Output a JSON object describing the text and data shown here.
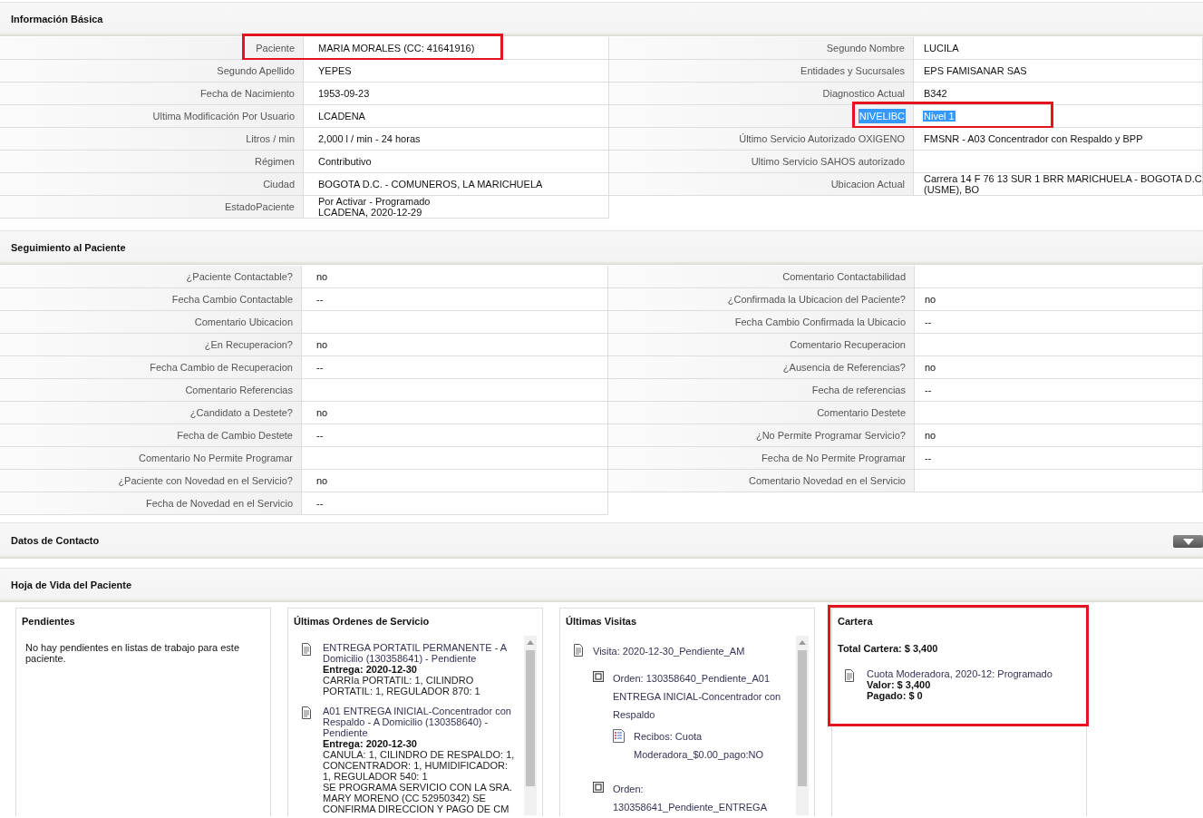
{
  "info_basica": {
    "title": "Información Básica",
    "left_rows": [
      {
        "label": "Paciente",
        "value": "MARIA MORALES (CC: 41641916)",
        "marked": true,
        "selected": false
      },
      {
        "label": "Segundo Apellido",
        "value": "YEPES",
        "marked": false,
        "selected": false
      },
      {
        "label": "Fecha de Nacimiento",
        "value": "1953-09-23",
        "marked": false,
        "selected": false
      },
      {
        "label": "Ultima Modificación Por Usuario",
        "value": "LCADENA",
        "marked": false,
        "selected": false
      },
      {
        "label": "Litros / min",
        "value": "2,000 l / min - 24 horas",
        "marked": false,
        "selected": false
      },
      {
        "label": "Régimen",
        "value": "Contributivo",
        "marked": false,
        "selected": false
      },
      {
        "label": "Ciudad",
        "value": "BOGOTA D.C. - COMUNEROS, LA MARICHUELA",
        "marked": false,
        "selected": false
      },
      {
        "label": "EstadoPaciente",
        "value": "Por Activar - Programado\nLCADENA, 2020-12-29",
        "marked": false,
        "selected": false
      }
    ],
    "right_rows": [
      {
        "label": "Segundo Nombre",
        "value": "LUCILA",
        "marked": false,
        "selected": false
      },
      {
        "label": "Entidades y Sucursales",
        "value": "EPS FAMISANAR SAS",
        "marked": false,
        "selected": false
      },
      {
        "label": "Diagnostico Actual",
        "value": "B342",
        "marked": false,
        "selected": false
      },
      {
        "label": "NIVELIBC",
        "value": "Nivel 1",
        "marked": true,
        "selected": true
      },
      {
        "label": "Último Servicio Autorizado OXIGENO",
        "value": "FMSNR - A03 Concentrador con Respaldo y BPP",
        "marked": false,
        "selected": false
      },
      {
        "label": "Ultimo Servicio SAHOS autorizado",
        "marked": false,
        "selected": false
      },
      {
        "label": "Ubicacion Actual",
        "value": "Carrera 14 F 76 13 SUR 1 BRR MARICHUELA - BOGOTA D.C.\n(USME), BO",
        "marked": false,
        "selected": false
      }
    ]
  },
  "seguimiento": {
    "title": "Seguimiento al Paciente",
    "left_rows": [
      {
        "label": "¿Paciente Contactable?",
        "value": "no"
      },
      {
        "label": "Fecha Cambio Contactable",
        "value": "--"
      },
      {
        "label": "Comentario Ubicacion"
      },
      {
        "label": "¿En Recuperacion?",
        "value": "no"
      },
      {
        "label": "Fecha Cambio de Recuperacion",
        "value": "--"
      },
      {
        "label": "Comentario Referencias"
      },
      {
        "label": "¿Candidato a Destete?",
        "value": "no"
      },
      {
        "label": "Fecha de Cambio Destete",
        "value": "--"
      },
      {
        "label": "Comentario No Permite Programar"
      },
      {
        "label": "¿Paciente con Novedad en el Servicio?",
        "value": "no"
      },
      {
        "label": "Fecha de Novedad en el Servicio",
        "value": "--"
      }
    ],
    "right_rows": [
      {
        "label": "Comentario Contactabilidad"
      },
      {
        "label": "¿Confirmada la Ubicacion del Paciente?",
        "value": "no"
      },
      {
        "label": "Fecha Cambio Confirmada la Ubicacio",
        "value": "--"
      },
      {
        "label": "Comentario Recuperacion"
      },
      {
        "label": "¿Ausencia de Referencias?",
        "value": "no"
      },
      {
        "label": "Fecha de referencias",
        "value": "--"
      },
      {
        "label": "Comentario Destete"
      },
      {
        "label": "¿No Permite Programar Servicio?",
        "value": "no"
      },
      {
        "label": "Fecha de No Permite Programar",
        "value": "--"
      },
      {
        "label": "Comentario Novedad en el Servicio"
      }
    ]
  },
  "contacto": {
    "title": "Datos de Contacto",
    "expanded": false
  },
  "hoja_de_vida": {
    "title": "Hoja de Vida del Paciente",
    "pendientes": {
      "title": "Pendientes",
      "text": "No hay pendientes en listas de trabajo para este paciente.",
      "marked": false
    },
    "ordenes": {
      "title": "Últimas Ordenes de Servicio",
      "marked": false,
      "items": [
        {
          "title": "ENTREGA PORTATIL PERMANENTE - A Domicilio (130358641) - Pendiente",
          "delivery": "Entrega: 2020-12-30",
          "details": "CARRIa PORTATIL: 1, CILINDRO PORTATIL: 1, REGULADOR 870: 1"
        },
        {
          "title": "A01 ENTREGA INICIAL-Concentrador con Respaldo - A Domicilio (130358640) - Pendiente",
          "delivery": "Entrega: 2020-12-30",
          "details": "CANULA: 1, CILINDRO DE RESPALDO: 1, CONCENTRADOR: 1, HUMIDIFICADOR: 1, REGULADOR 540: 1\nSE PROGRAMA SERVICIO CON LA SRA. MARY MORENO (CC 52950342) SE CONFIRMA DIRECCION Y PAGO DE CM"
        }
      ]
    },
    "visitas": {
      "title": "Últimas Visitas",
      "marked": false,
      "items": [
        {
          "kind": "visita",
          "text": "Visita: 2020-12-30_Pendiente_AM",
          "children": [
            {
              "kind": "orden",
              "text": "Orden: 130358640_Pendiente_A01 ENTREGA INICIAL-Concentrador con Respaldo",
              "children": [
                {
                  "kind": "recibo",
                  "text": "Recibos: Cuota Moderadora_$0.00_pago:NO"
                }
              ]
            },
            {
              "kind": "orden",
              "text": "Orden: 130358641_Pendiente_ENTREGA"
            }
          ]
        }
      ]
    },
    "cartera": {
      "title": "Cartera",
      "total": "Total Cartera: $ 3,400",
      "marked": true,
      "items": [
        {
          "title": "Cuota Moderadora, 2020-12: Programado",
          "valor": "Valor: $ 3,400",
          "pagado": "Pagado: $ 0"
        }
      ]
    }
  }
}
